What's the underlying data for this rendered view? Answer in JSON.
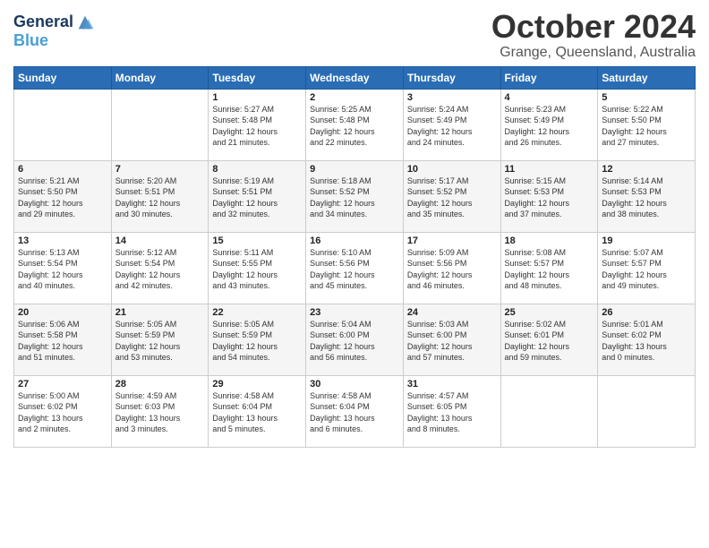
{
  "header": {
    "logo_line1": "General",
    "logo_line2": "Blue",
    "month": "October 2024",
    "location": "Grange, Queensland, Australia"
  },
  "weekdays": [
    "Sunday",
    "Monday",
    "Tuesday",
    "Wednesday",
    "Thursday",
    "Friday",
    "Saturday"
  ],
  "weeks": [
    [
      {
        "day": "",
        "info": ""
      },
      {
        "day": "",
        "info": ""
      },
      {
        "day": "1",
        "info": "Sunrise: 5:27 AM\nSunset: 5:48 PM\nDaylight: 12 hours\nand 21 minutes."
      },
      {
        "day": "2",
        "info": "Sunrise: 5:25 AM\nSunset: 5:48 PM\nDaylight: 12 hours\nand 22 minutes."
      },
      {
        "day": "3",
        "info": "Sunrise: 5:24 AM\nSunset: 5:49 PM\nDaylight: 12 hours\nand 24 minutes."
      },
      {
        "day": "4",
        "info": "Sunrise: 5:23 AM\nSunset: 5:49 PM\nDaylight: 12 hours\nand 26 minutes."
      },
      {
        "day": "5",
        "info": "Sunrise: 5:22 AM\nSunset: 5:50 PM\nDaylight: 12 hours\nand 27 minutes."
      }
    ],
    [
      {
        "day": "6",
        "info": "Sunrise: 5:21 AM\nSunset: 5:50 PM\nDaylight: 12 hours\nand 29 minutes."
      },
      {
        "day": "7",
        "info": "Sunrise: 5:20 AM\nSunset: 5:51 PM\nDaylight: 12 hours\nand 30 minutes."
      },
      {
        "day": "8",
        "info": "Sunrise: 5:19 AM\nSunset: 5:51 PM\nDaylight: 12 hours\nand 32 minutes."
      },
      {
        "day": "9",
        "info": "Sunrise: 5:18 AM\nSunset: 5:52 PM\nDaylight: 12 hours\nand 34 minutes."
      },
      {
        "day": "10",
        "info": "Sunrise: 5:17 AM\nSunset: 5:52 PM\nDaylight: 12 hours\nand 35 minutes."
      },
      {
        "day": "11",
        "info": "Sunrise: 5:15 AM\nSunset: 5:53 PM\nDaylight: 12 hours\nand 37 minutes."
      },
      {
        "day": "12",
        "info": "Sunrise: 5:14 AM\nSunset: 5:53 PM\nDaylight: 12 hours\nand 38 minutes."
      }
    ],
    [
      {
        "day": "13",
        "info": "Sunrise: 5:13 AM\nSunset: 5:54 PM\nDaylight: 12 hours\nand 40 minutes."
      },
      {
        "day": "14",
        "info": "Sunrise: 5:12 AM\nSunset: 5:54 PM\nDaylight: 12 hours\nand 42 minutes."
      },
      {
        "day": "15",
        "info": "Sunrise: 5:11 AM\nSunset: 5:55 PM\nDaylight: 12 hours\nand 43 minutes."
      },
      {
        "day": "16",
        "info": "Sunrise: 5:10 AM\nSunset: 5:56 PM\nDaylight: 12 hours\nand 45 minutes."
      },
      {
        "day": "17",
        "info": "Sunrise: 5:09 AM\nSunset: 5:56 PM\nDaylight: 12 hours\nand 46 minutes."
      },
      {
        "day": "18",
        "info": "Sunrise: 5:08 AM\nSunset: 5:57 PM\nDaylight: 12 hours\nand 48 minutes."
      },
      {
        "day": "19",
        "info": "Sunrise: 5:07 AM\nSunset: 5:57 PM\nDaylight: 12 hours\nand 49 minutes."
      }
    ],
    [
      {
        "day": "20",
        "info": "Sunrise: 5:06 AM\nSunset: 5:58 PM\nDaylight: 12 hours\nand 51 minutes."
      },
      {
        "day": "21",
        "info": "Sunrise: 5:05 AM\nSunset: 5:59 PM\nDaylight: 12 hours\nand 53 minutes."
      },
      {
        "day": "22",
        "info": "Sunrise: 5:05 AM\nSunset: 5:59 PM\nDaylight: 12 hours\nand 54 minutes."
      },
      {
        "day": "23",
        "info": "Sunrise: 5:04 AM\nSunset: 6:00 PM\nDaylight: 12 hours\nand 56 minutes."
      },
      {
        "day": "24",
        "info": "Sunrise: 5:03 AM\nSunset: 6:00 PM\nDaylight: 12 hours\nand 57 minutes."
      },
      {
        "day": "25",
        "info": "Sunrise: 5:02 AM\nSunset: 6:01 PM\nDaylight: 12 hours\nand 59 minutes."
      },
      {
        "day": "26",
        "info": "Sunrise: 5:01 AM\nSunset: 6:02 PM\nDaylight: 13 hours\nand 0 minutes."
      }
    ],
    [
      {
        "day": "27",
        "info": "Sunrise: 5:00 AM\nSunset: 6:02 PM\nDaylight: 13 hours\nand 2 minutes."
      },
      {
        "day": "28",
        "info": "Sunrise: 4:59 AM\nSunset: 6:03 PM\nDaylight: 13 hours\nand 3 minutes."
      },
      {
        "day": "29",
        "info": "Sunrise: 4:58 AM\nSunset: 6:04 PM\nDaylight: 13 hours\nand 5 minutes."
      },
      {
        "day": "30",
        "info": "Sunrise: 4:58 AM\nSunset: 6:04 PM\nDaylight: 13 hours\nand 6 minutes."
      },
      {
        "day": "31",
        "info": "Sunrise: 4:57 AM\nSunset: 6:05 PM\nDaylight: 13 hours\nand 8 minutes."
      },
      {
        "day": "",
        "info": ""
      },
      {
        "day": "",
        "info": ""
      }
    ]
  ]
}
